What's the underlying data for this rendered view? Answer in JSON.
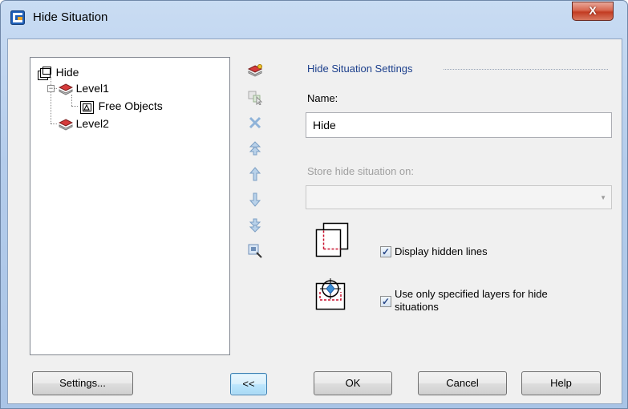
{
  "window": {
    "title": "Hide Situation",
    "close_label": "X"
  },
  "tree": {
    "items": [
      {
        "label": "Hide",
        "icon": "hide-situation-icon"
      },
      {
        "label": "Level1",
        "icon": "level-icon"
      },
      {
        "label": "Free Objects",
        "icon": "free-objects-icon"
      },
      {
        "label": "Level2",
        "icon": "level-icon"
      }
    ]
  },
  "toolbar": {
    "items": [
      "new-level-icon",
      "add-objects-icon",
      "delete-icon",
      "move-to-top-icon",
      "move-up-icon",
      "move-down-icon",
      "move-to-bottom-icon",
      "zoom-selection-icon"
    ]
  },
  "settings": {
    "section_title": "Hide Situation Settings",
    "name_label": "Name:",
    "name_value": "Hide",
    "store_label": "Store hide situation on:",
    "store_value": "",
    "display_hidden_lines": {
      "label": "Display hidden lines",
      "checked": true
    },
    "use_specified_layers": {
      "label_line1": "Use only specified layers for hide",
      "label_line2": "situations",
      "checked": true
    }
  },
  "buttons": {
    "settings": "Settings...",
    "collapse": "<<",
    "ok": "OK",
    "cancel": "Cancel",
    "help": "Help"
  }
}
